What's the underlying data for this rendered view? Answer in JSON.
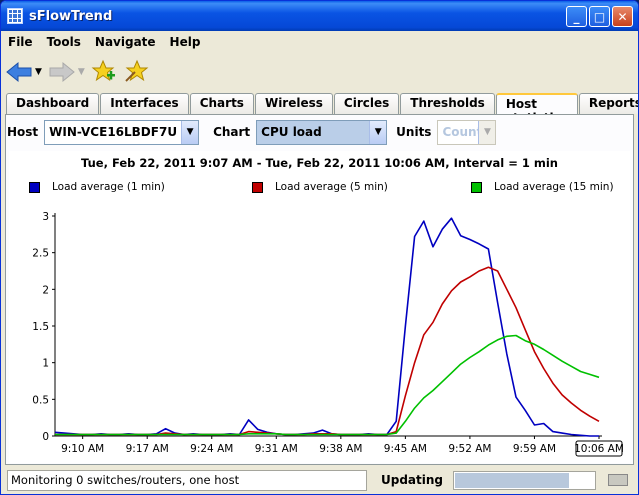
{
  "window": {
    "title": "sFlowTrend",
    "buttons": {
      "minimize": "_",
      "maximize": "□",
      "close": "✕"
    }
  },
  "menu": [
    "File",
    "Tools",
    "Navigate",
    "Help"
  ],
  "toolbar": {
    "icons": [
      "back-arrow-icon",
      "forward-arrow-icon",
      "add-favorite-icon",
      "favorites-icon"
    ]
  },
  "tabs": [
    "Dashboard",
    "Interfaces",
    "Charts",
    "Wireless",
    "Circles",
    "Thresholds",
    "Host statistics",
    "Reports"
  ],
  "active_tab": "Host statistics",
  "controls": {
    "host_label": "Host",
    "host_value": "WIN-VCE16LBDF7U",
    "chart_label": "Chart",
    "chart_value": "CPU load",
    "units_label": "Units",
    "units_value": "Count"
  },
  "chart_data": {
    "type": "line",
    "title": "Tue, Feb 22, 2011 9:07 AM - Tue, Feb 22, 2011 10:06 AM, Interval = 1 min",
    "xlabel": "",
    "ylabel": "",
    "ylim": [
      0,
      3
    ],
    "y_ticks": [
      "0",
      "0.5",
      "1",
      "1.5",
      "2",
      "2.5",
      "3"
    ],
    "x_ticks": [
      "9:10 AM",
      "9:17 AM",
      "9:24 AM",
      "9:31 AM",
      "9:38 AM",
      "9:45 AM",
      "9:52 AM",
      "9:59 AM",
      "10:06 AM"
    ],
    "x_minutes": [
      0,
      1,
      2,
      3,
      4,
      5,
      6,
      7,
      8,
      9,
      10,
      11,
      12,
      13,
      14,
      15,
      16,
      17,
      18,
      19,
      20,
      21,
      22,
      23,
      24,
      25,
      26,
      27,
      28,
      29,
      30,
      31,
      32,
      33,
      34,
      35,
      36,
      37,
      38,
      39,
      40,
      41,
      42,
      43,
      44,
      45,
      46,
      47,
      48,
      49,
      50,
      51,
      52,
      53,
      54,
      55,
      56,
      57,
      58,
      59
    ],
    "legend_position": "top",
    "series": [
      {
        "name": "Load average (1 min)",
        "color": "#0000c0",
        "values": [
          0.05,
          0.04,
          0.03,
          0.02,
          0.02,
          0.03,
          0.02,
          0.02,
          0.03,
          0.02,
          0.02,
          0.03,
          0.1,
          0.04,
          0.02,
          0.03,
          0.02,
          0.02,
          0.02,
          0.03,
          0.02,
          0.22,
          0.09,
          0.05,
          0.03,
          0.02,
          0.02,
          0.03,
          0.04,
          0.08,
          0.03,
          0.02,
          0.02,
          0.02,
          0.03,
          0.02,
          0.02,
          0.2,
          1.5,
          2.72,
          2.93,
          2.58,
          2.82,
          2.97,
          2.73,
          2.68,
          2.62,
          2.55,
          1.82,
          1.12,
          0.53,
          0.35,
          0.15,
          0.17,
          0.06,
          0.04,
          0.02,
          0.01,
          0.0,
          0.0
        ]
      },
      {
        "name": "Load average (5 min)",
        "color": "#c00000",
        "values": [
          0.02,
          0.02,
          0.02,
          0.02,
          0.02,
          0.02,
          0.02,
          0.02,
          0.02,
          0.02,
          0.02,
          0.02,
          0.04,
          0.03,
          0.02,
          0.02,
          0.02,
          0.02,
          0.02,
          0.02,
          0.02,
          0.06,
          0.05,
          0.04,
          0.03,
          0.02,
          0.02,
          0.02,
          0.03,
          0.03,
          0.03,
          0.02,
          0.02,
          0.02,
          0.02,
          0.02,
          0.02,
          0.06,
          0.55,
          1.0,
          1.38,
          1.55,
          1.8,
          1.98,
          2.1,
          2.17,
          2.25,
          2.3,
          2.25,
          2.0,
          1.75,
          1.45,
          1.15,
          0.92,
          0.72,
          0.56,
          0.45,
          0.35,
          0.27,
          0.2
        ]
      },
      {
        "name": "Load average (15 min)",
        "color": "#00c000",
        "values": [
          0.02,
          0.02,
          0.02,
          0.02,
          0.02,
          0.02,
          0.02,
          0.02,
          0.02,
          0.02,
          0.02,
          0.02,
          0.02,
          0.02,
          0.02,
          0.02,
          0.02,
          0.02,
          0.02,
          0.02,
          0.02,
          0.03,
          0.03,
          0.03,
          0.03,
          0.02,
          0.02,
          0.02,
          0.02,
          0.02,
          0.02,
          0.02,
          0.02,
          0.02,
          0.02,
          0.02,
          0.02,
          0.04,
          0.2,
          0.38,
          0.52,
          0.62,
          0.74,
          0.86,
          0.98,
          1.07,
          1.15,
          1.24,
          1.31,
          1.36,
          1.37,
          1.3,
          1.25,
          1.18,
          1.1,
          1.02,
          0.95,
          0.88,
          0.84,
          0.8
        ]
      }
    ]
  },
  "status": {
    "message": "Monitoring 0 switches/routers, one host",
    "updating_label": "Updating",
    "progress": 0.82
  }
}
